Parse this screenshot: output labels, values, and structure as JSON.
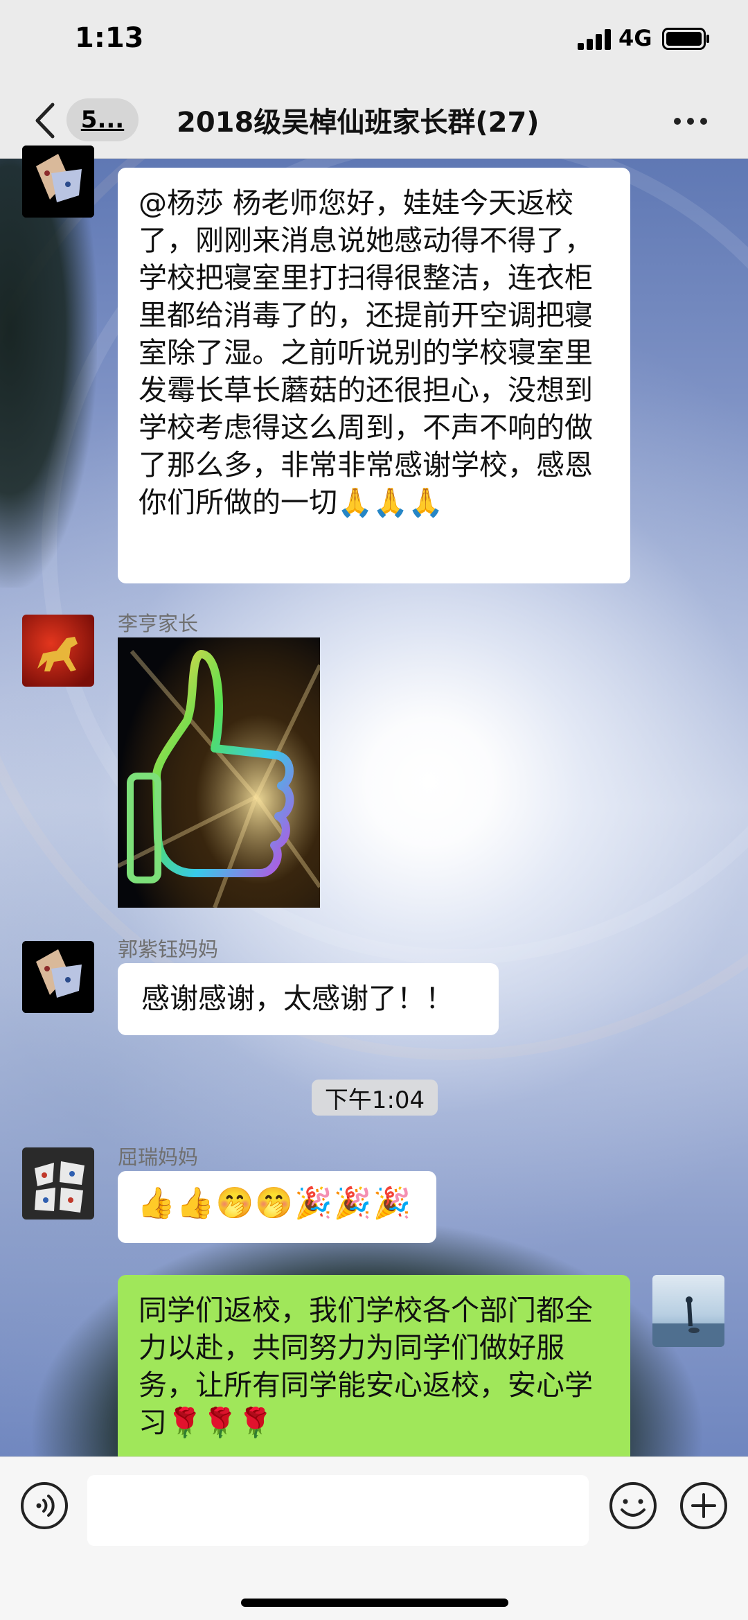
{
  "status_bar": {
    "time": "1:13",
    "network": "4G"
  },
  "nav": {
    "back_badge": "5...",
    "title": "2018级吴棹仙班家长群(27)",
    "back_icon": "chevron-left-icon",
    "more_icon": "more-horizontal-icon"
  },
  "messages": [
    {
      "sender": "",
      "type": "text",
      "text": "@杨莎 杨老师您好，娃娃今天返校了，刚刚来消息说她感动得不得了，学校把寝室里打扫得很整洁，连衣柜里都给消毒了的，还提前开空调把寝室除了湿。之前听说别的学校寝室里发霉长草长蘑菇的还很担心，没想到学校考虑得这么周到，不声不响的做了那么多，非常非常感谢学校，感恩你们所做的一切🙏🙏🙏",
      "side": "left"
    },
    {
      "sender": "李亨家长",
      "type": "sticker",
      "sticker": "rainbow-thumbs-up-sticker",
      "side": "left"
    },
    {
      "sender": "郭紫钰妈妈",
      "type": "text",
      "text": "感谢感谢，太感谢了！！",
      "side": "left"
    },
    {
      "sender": "屈瑞妈妈",
      "type": "text",
      "text": "👍👍🤭🤭🎉🎉🎉",
      "side": "left"
    },
    {
      "sender": "",
      "type": "text",
      "text": "同学们返校，我们学校各个部门都全力以赴，共同努力为同学们做好服务，让所有同学能安心返校，安心学习🌹🌹🌹",
      "side": "right"
    }
  ],
  "time_divider": "下午1:04",
  "input_bar": {
    "placeholder": "",
    "voice_icon": "voice-icon",
    "emoji_icon": "emoji-icon",
    "add_icon": "plus-circle-icon"
  },
  "colors": {
    "outgoing_bubble": "#a0e75a",
    "incoming_bubble": "#ffffff",
    "bar_background": "#ebebeb"
  }
}
